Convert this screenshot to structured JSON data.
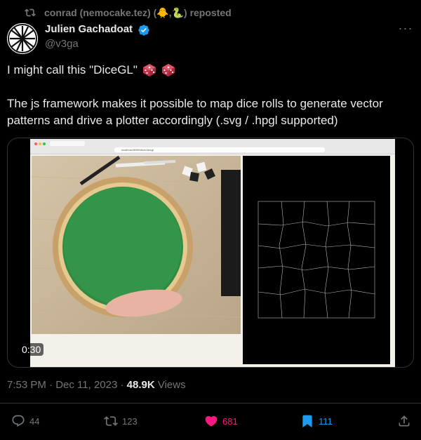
{
  "repost": {
    "icon": "repost-icon",
    "text": "conrad (nemocake.tez) (🐥,🐍) reposted"
  },
  "author": {
    "name": "Julien Gachadoat",
    "handle": "@v3ga",
    "verified": true,
    "verified_color": "#1d9bf0"
  },
  "more_label": "···",
  "tweet": {
    "line1": "I might call this \"DiceGL\"",
    "line2": "The js framework makes it possible to map dice rolls to generate vector patterns and drive a plotter accordingly (.svg / .hpgl supported)"
  },
  "media": {
    "timecode": "0:30",
    "url_text": "localhost:8080/dice/dicegl"
  },
  "meta": {
    "time": "7:53 PM · Dec 11, 2023 · ",
    "views_count": "48.9K",
    "views_label": " Views"
  },
  "actions": {
    "replies": "44",
    "reposts": "123",
    "likes": "681",
    "bookmarks": "111"
  },
  "colors": {
    "like": "#f91880",
    "bookmark": "#1d9bf0",
    "muted": "#71767b",
    "text": "#e7e9ea"
  }
}
